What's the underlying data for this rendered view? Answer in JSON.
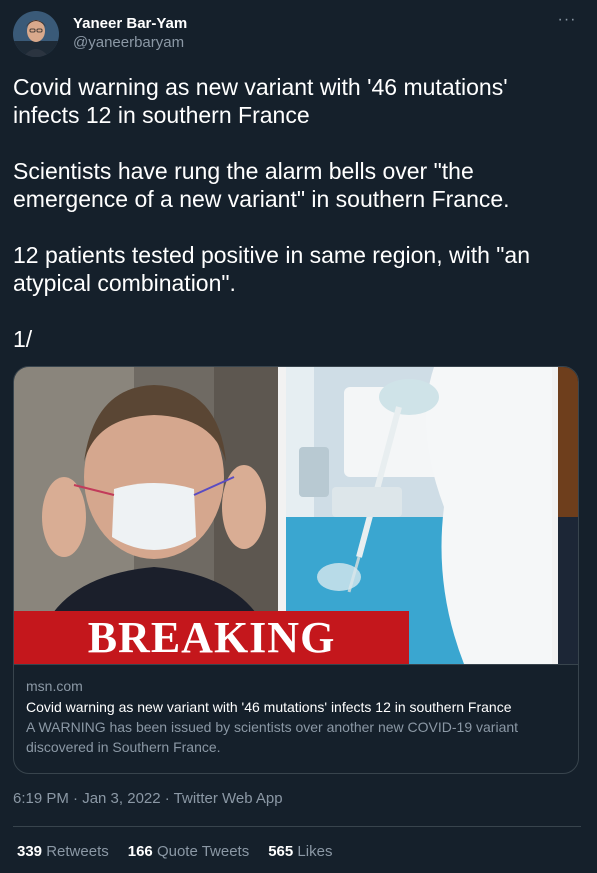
{
  "author": {
    "display_name": "Yaneer Bar-Yam",
    "handle": "@yaneerbaryam"
  },
  "more_icon": "more-horizontal-icon",
  "tweet_text": {
    "p1": "Covid warning as new variant with '46 mutations' infects 12 in southern France",
    "p2": "Scientists have rung the alarm bells over \"the emergence of a new variant\" in southern France.",
    "p3": "12 patients tested positive in same region, with \"an atypical combination\".",
    "p4": "1/"
  },
  "card": {
    "image_banner_text": "BREAKING",
    "domain": "msn.com",
    "title": "Covid warning as new variant with '46 mutations' infects 12 in southern France",
    "description": "A WARNING has been issued by scientists over another new COVID-19 variant discovered in Southern France."
  },
  "meta": {
    "timestamp": "6:19 PM · Jan 3, 2022 · Twitter Web App"
  },
  "stats": {
    "retweets_count": "339",
    "retweets_label": "Retweets",
    "quotes_count": "166",
    "quotes_label": "Quote Tweets",
    "likes_count": "565",
    "likes_label": "Likes"
  },
  "colors": {
    "background": "#15202b",
    "border": "#38444d",
    "secondary_text": "#8b98a5",
    "breaking_red": "#c4171c"
  }
}
